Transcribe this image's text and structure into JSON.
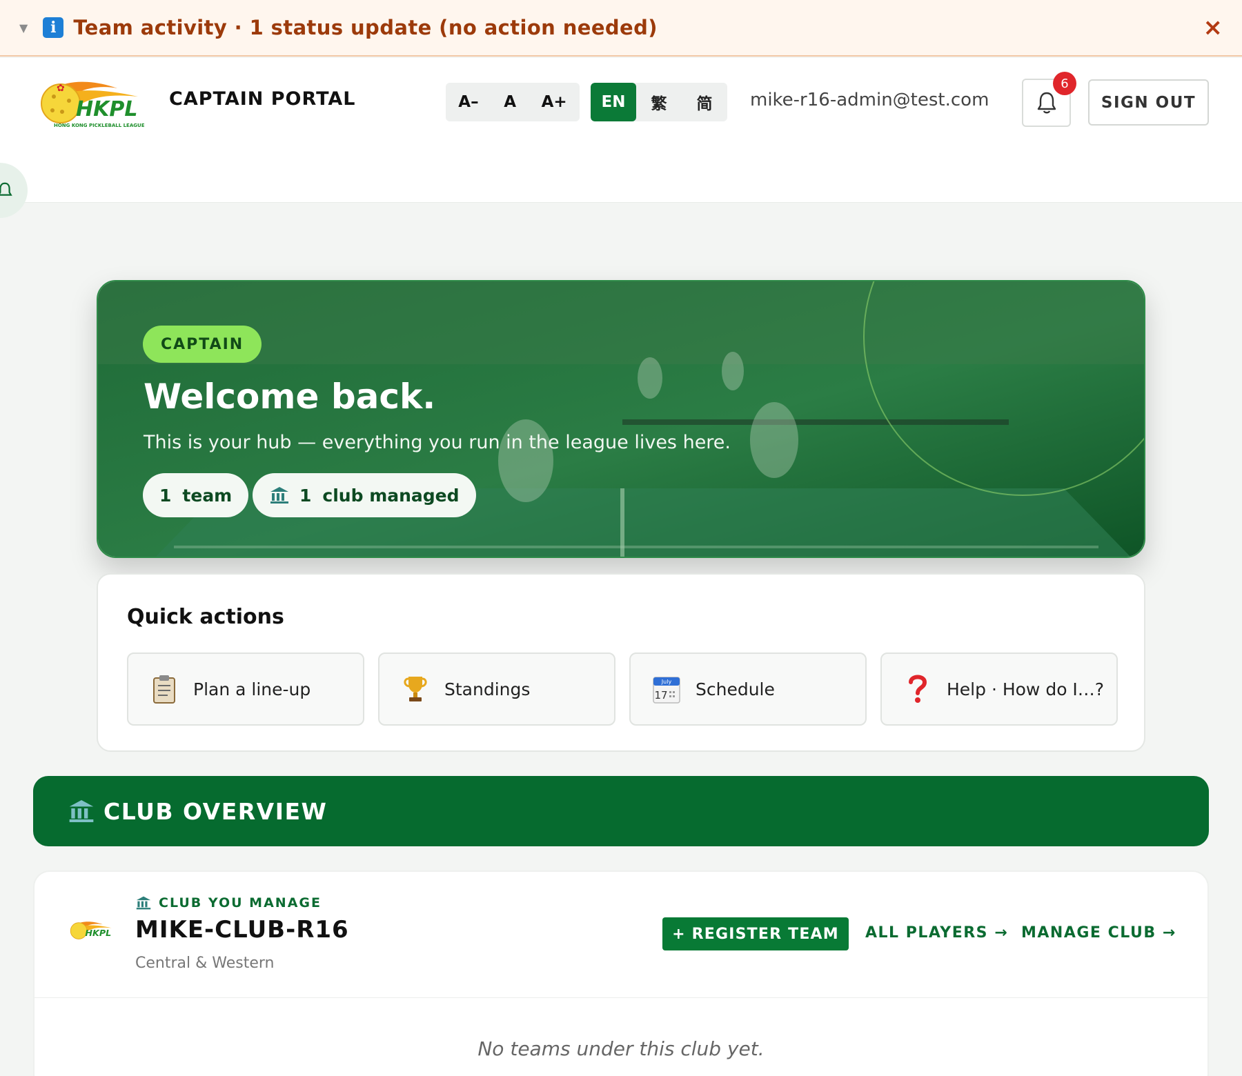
{
  "banner": {
    "text": "Team activity · 1 status update (no action needed)",
    "close_label": "×"
  },
  "header": {
    "portal_title": "CAPTAIN PORTAL",
    "font_controls": [
      "A–",
      "A",
      "A+"
    ],
    "languages": [
      "EN",
      "繁",
      "简"
    ],
    "active_language": "EN",
    "user_email": "mike-r16-admin@test.com",
    "notification_count": "6",
    "sign_out_label": "SIGN OUT",
    "logo_text": "HKPL",
    "logo_subtext": "HONG KONG PICKLEBALL LEAGUE"
  },
  "hero": {
    "badge": "CAPTAIN",
    "title": "Welcome back.",
    "subtitle": "This is your hub — everything you run in the league lives here.",
    "team_count": "1",
    "team_label": "team",
    "club_count": "1",
    "club_label": "club managed"
  },
  "quick_actions": {
    "title": "Quick actions",
    "items": [
      {
        "label": "Plan a line-up",
        "icon": "clipboard-icon"
      },
      {
        "label": "Standings",
        "icon": "trophy-icon"
      },
      {
        "label": "Schedule",
        "icon": "calendar-icon"
      },
      {
        "label": "Help · How do I…?",
        "icon": "question-icon"
      }
    ],
    "calendar_month": "July",
    "calendar_day": "17"
  },
  "overview": {
    "title": "CLUB OVERVIEW"
  },
  "club": {
    "eyebrow": "CLUB YOU MANAGE",
    "name": "MIKE-CLUB-R16",
    "region": "Central & Western",
    "register_label": "+ REGISTER TEAM",
    "all_players_label": "ALL PLAYERS →",
    "manage_label": "MANAGE CLUB →",
    "empty_text": "No teams under this club yet."
  },
  "colors": {
    "brand_green": "#066b2f",
    "accent_lime": "#8ee55a",
    "banner_text": "#9c3a0a",
    "badge_red": "#e0262b"
  }
}
